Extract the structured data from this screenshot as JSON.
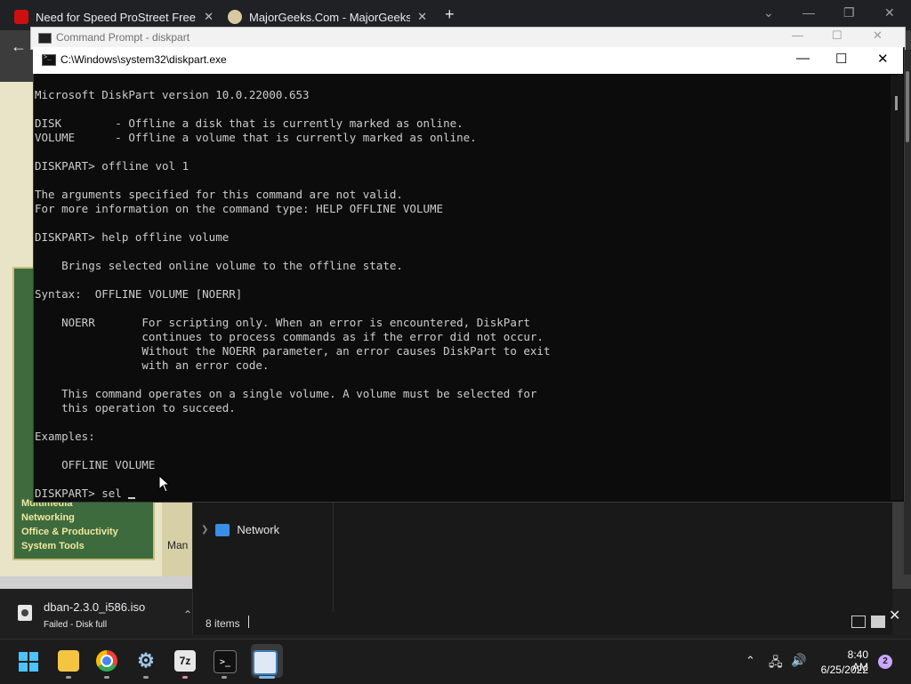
{
  "browser": {
    "tabs": [
      {
        "label": "Need for Speed ProStreet Free D",
        "favicon_color": "#cc1010"
      },
      {
        "label": "MajorGeeks.Com - MajorGeeks",
        "favicon_color": "#d9c9a0"
      }
    ],
    "new_tab_label": "+",
    "close_glyph": "✕"
  },
  "majorgeeks": {
    "links": [
      "Multimedia",
      "Networking",
      "Office & Productivity",
      "System Tools"
    ],
    "mid_text": "Man"
  },
  "background_cmd": {
    "title": "Command Prompt - diskpart"
  },
  "diskpart_window": {
    "title": "C:\\Windows\\system32\\diskpart.exe",
    "lines": [
      "Microsoft DiskPart version 10.0.22000.653",
      "",
      "DISK        - Offline a disk that is currently marked as online.",
      "VOLUME      - Offline a volume that is currently marked as online.",
      "",
      "DISKPART> offline vol 1",
      "",
      "The arguments specified for this command are not valid.",
      "For more information on the command type: HELP OFFLINE VOLUME",
      "",
      "DISKPART> help offline volume",
      "",
      "    Brings selected online volume to the offline state.",
      "",
      "Syntax:  OFFLINE VOLUME [NOERR]",
      "",
      "    NOERR       For scripting only. When an error is encountered, DiskPart",
      "                continues to process commands as if the error did not occur.",
      "                Without the NOERR parameter, an error causes DiskPart to exit",
      "                with an error code.",
      "",
      "    This command operates on a single volume. A volume must be selected for",
      "    this operation to succeed.",
      "",
      "Examples:",
      "",
      "    OFFLINE VOLUME",
      ""
    ],
    "prompt_line": "DISKPART> sel "
  },
  "explorer": {
    "nav_item": "Network",
    "status_items": "8 items"
  },
  "download": {
    "file_name": "dban-2.3.0_i586.iso",
    "status": "Failed - Disk full"
  },
  "taskbar": {
    "apps": [
      {
        "name": "File Explorer",
        "icon": "folder-icon"
      },
      {
        "name": "Chrome",
        "icon": "chrome-icon"
      },
      {
        "name": "Settings",
        "icon": "gear-icon"
      },
      {
        "name": "7-Zip",
        "icon": "7zip-icon",
        "text": "7z"
      },
      {
        "name": "Terminal",
        "icon": "terminal-icon"
      },
      {
        "name": "Notepad",
        "icon": "notepad-icon"
      }
    ],
    "clock_time": "8:40 AM",
    "clock_date": "6/25/2022",
    "notification_count": "2"
  }
}
